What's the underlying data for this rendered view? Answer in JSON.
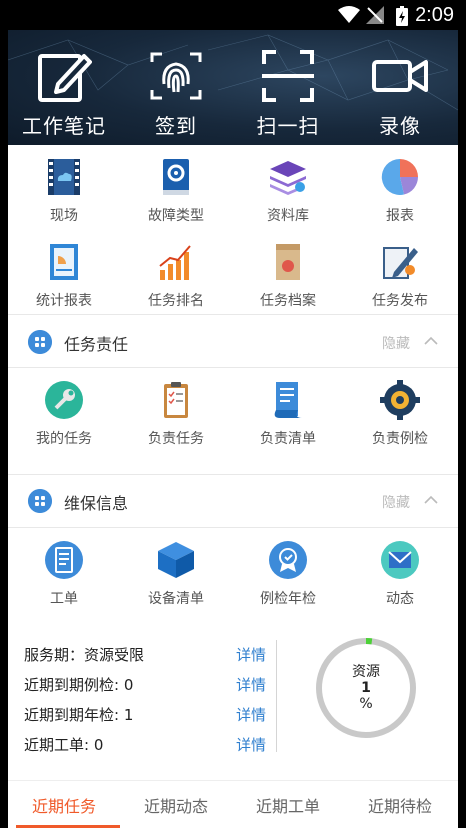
{
  "status_bar": {
    "time": "2:09"
  },
  "quick_actions": [
    {
      "label": "工作笔记",
      "icon": "edit-note-icon"
    },
    {
      "label": "签到",
      "icon": "fingerprint-icon"
    },
    {
      "label": "扫一扫",
      "icon": "scan-icon"
    },
    {
      "label": "录像",
      "icon": "video-camera-icon"
    }
  ],
  "grid_row1": [
    {
      "label": "现场",
      "icon": "film-cloud-icon"
    },
    {
      "label": "故障类型",
      "icon": "gear-book-icon"
    },
    {
      "label": "资料库",
      "icon": "stacked-layers-icon"
    },
    {
      "label": "报表",
      "icon": "pie-chart-icon"
    }
  ],
  "grid_row2": [
    {
      "label": "统计报表",
      "icon": "stat-report-icon"
    },
    {
      "label": "任务排名",
      "icon": "bar-ranking-icon"
    },
    {
      "label": "任务档案",
      "icon": "archive-box-icon"
    },
    {
      "label": "任务发布",
      "icon": "pen-publish-icon"
    }
  ],
  "section_task": {
    "title": "任务责任",
    "toggle": "隐藏"
  },
  "task_items": [
    {
      "label": "我的任务",
      "icon": "wrench-circle-icon"
    },
    {
      "label": "负责任务",
      "icon": "clipboard-check-icon"
    },
    {
      "label": "负责清单",
      "icon": "checklist-scroll-icon"
    },
    {
      "label": "负责例检",
      "icon": "gear-inspect-icon"
    }
  ],
  "section_maint": {
    "title": "维保信息",
    "toggle": "隐藏"
  },
  "maint_items": [
    {
      "label": "工单",
      "icon": "work-order-icon"
    },
    {
      "label": "设备清单",
      "icon": "cube-icon"
    },
    {
      "label": "例检年检",
      "icon": "badge-check-icon"
    },
    {
      "label": "动态",
      "icon": "mail-icon"
    }
  ],
  "info": {
    "service": "服务期：资源受限",
    "routine_due": "近期到期例检: 0",
    "annual_due": "近期到期年检: 1",
    "work_orders": "近期工单: 0",
    "detail_label": "详情"
  },
  "resource_ring": {
    "label": "资源",
    "value": "1",
    "unit": "%",
    "percent": 1
  },
  "tabs": [
    "近期任务",
    "近期动态",
    "近期工单",
    "近期待检"
  ],
  "colors": {
    "accent": "#f05a2a",
    "link": "#2f7fcf",
    "section_bullet": "#3d8bd9",
    "ring_fill": "#4cd137"
  }
}
